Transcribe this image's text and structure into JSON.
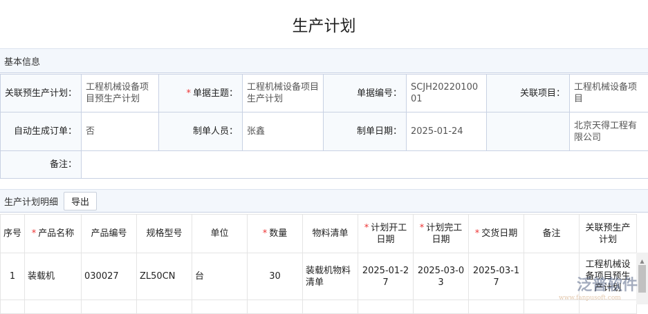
{
  "title": "生产计划",
  "basic": {
    "section": "基本信息",
    "rows": [
      [
        {
          "label": "关联预生产计划：",
          "value": "工程机械设备项目预生产计划"
        },
        {
          "label": "单据主题：",
          "value": "工程机械设备项目生产计划",
          "required": true
        },
        {
          "label": "单据编号：",
          "value": "SCJH2022010001"
        },
        {
          "label": "关联项目：",
          "value": "工程机械设备项目"
        }
      ],
      [
        {
          "label": "自动生成订单：",
          "value": "否"
        },
        {
          "label": "制单人员：",
          "value": "张鑫"
        },
        {
          "label": "制单日期：",
          "value": "2025-01-24"
        },
        {
          "label": "",
          "value": "北京天得工程有限公司"
        }
      ]
    ],
    "remark_label": "备注："
  },
  "detail": {
    "section": "生产计划明细",
    "export": "导出",
    "columns": [
      "序号",
      "产品名称",
      "产品编号",
      "规格型号",
      "单位",
      "数量",
      "物料清单",
      "计划开工日期",
      "计划完工日期",
      "交货日期",
      "备注",
      "关联预生产计划"
    ],
    "rows": [
      [
        "1",
        "装载机",
        "030027",
        "ZL50CN",
        "台",
        "30",
        "装载机物料清单",
        "2025-01-27",
        "2025-03-03",
        "2025-03-17",
        "",
        "工程机械设备项目预生产计划"
      ]
    ]
  },
  "required_mark": "*",
  "watermark": {
    "cn": "泛普软件",
    "en": "www.fanpusoft.com"
  }
}
